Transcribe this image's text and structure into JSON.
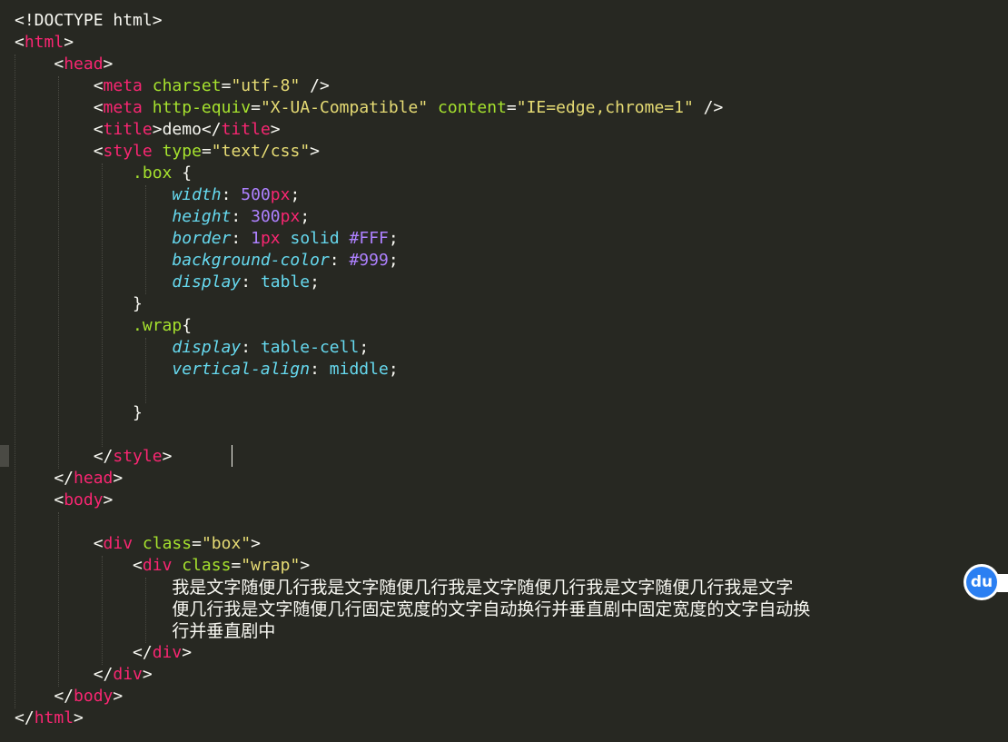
{
  "editor": {
    "lines": [
      [
        {
          "t": "<!DOCTYPE html>",
          "c": "fg"
        }
      ],
      [
        {
          "t": "<",
          "c": "fg"
        },
        {
          "t": "html",
          "c": "tg"
        },
        {
          "t": ">",
          "c": "fg"
        }
      ],
      [
        {
          "t": "    <",
          "c": "fg"
        },
        {
          "t": "head",
          "c": "tg"
        },
        {
          "t": ">",
          "c": "fg"
        }
      ],
      [
        {
          "t": "        <",
          "c": "fg"
        },
        {
          "t": "meta",
          "c": "tg"
        },
        {
          "t": " ",
          "c": "fg"
        },
        {
          "t": "charset",
          "c": "at"
        },
        {
          "t": "=",
          "c": "fg"
        },
        {
          "t": "\"utf-8\"",
          "c": "st"
        },
        {
          "t": " />",
          "c": "fg"
        }
      ],
      [
        {
          "t": "        <",
          "c": "fg"
        },
        {
          "t": "meta",
          "c": "tg"
        },
        {
          "t": " ",
          "c": "fg"
        },
        {
          "t": "http-equiv",
          "c": "at"
        },
        {
          "t": "=",
          "c": "fg"
        },
        {
          "t": "\"X-UA-Compatible\"",
          "c": "st"
        },
        {
          "t": " ",
          "c": "fg"
        },
        {
          "t": "content",
          "c": "at"
        },
        {
          "t": "=",
          "c": "fg"
        },
        {
          "t": "\"IE=edge,chrome=1\"",
          "c": "st"
        },
        {
          "t": " />",
          "c": "fg"
        }
      ],
      [
        {
          "t": "        <",
          "c": "fg"
        },
        {
          "t": "title",
          "c": "tg"
        },
        {
          "t": ">demo</",
          "c": "fg"
        },
        {
          "t": "title",
          "c": "tg"
        },
        {
          "t": ">",
          "c": "fg"
        }
      ],
      [
        {
          "t": "        <",
          "c": "fg"
        },
        {
          "t": "style",
          "c": "tg"
        },
        {
          "t": " ",
          "c": "fg"
        },
        {
          "t": "type",
          "c": "at"
        },
        {
          "t": "=",
          "c": "fg"
        },
        {
          "t": "\"text/css\"",
          "c": "st"
        },
        {
          "t": ">",
          "c": "fg"
        }
      ],
      [
        {
          "t": "            ",
          "c": "fg"
        },
        {
          "t": ".box",
          "c": "sel"
        },
        {
          "t": " {",
          "c": "fg"
        }
      ],
      [
        {
          "t": "                ",
          "c": "fg"
        },
        {
          "t": "width",
          "c": "pr"
        },
        {
          "t": ": ",
          "c": "fg"
        },
        {
          "t": "500",
          "c": "nu"
        },
        {
          "t": "px",
          "c": "un"
        },
        {
          "t": ";",
          "c": "fg"
        }
      ],
      [
        {
          "t": "                ",
          "c": "fg"
        },
        {
          "t": "height",
          "c": "pr"
        },
        {
          "t": ": ",
          "c": "fg"
        },
        {
          "t": "300",
          "c": "nu"
        },
        {
          "t": "px",
          "c": "un"
        },
        {
          "t": ";",
          "c": "fg"
        }
      ],
      [
        {
          "t": "                ",
          "c": "fg"
        },
        {
          "t": "border",
          "c": "pr"
        },
        {
          "t": ": ",
          "c": "fg"
        },
        {
          "t": "1",
          "c": "nu"
        },
        {
          "t": "px",
          "c": "un"
        },
        {
          "t": " ",
          "c": "fg"
        },
        {
          "t": "solid",
          "c": "kw"
        },
        {
          "t": " ",
          "c": "fg"
        },
        {
          "t": "#FFF",
          "c": "nu"
        },
        {
          "t": ";",
          "c": "fg"
        }
      ],
      [
        {
          "t": "                ",
          "c": "fg"
        },
        {
          "t": "background-color",
          "c": "pr"
        },
        {
          "t": ": ",
          "c": "fg"
        },
        {
          "t": "#999",
          "c": "nu"
        },
        {
          "t": ";",
          "c": "fg"
        }
      ],
      [
        {
          "t": "                ",
          "c": "fg"
        },
        {
          "t": "display",
          "c": "pr"
        },
        {
          "t": ": ",
          "c": "fg"
        },
        {
          "t": "table",
          "c": "kw"
        },
        {
          "t": ";",
          "c": "fg"
        }
      ],
      [
        {
          "t": "            }",
          "c": "fg"
        }
      ],
      [
        {
          "t": "            ",
          "c": "fg"
        },
        {
          "t": ".wrap",
          "c": "sel"
        },
        {
          "t": "{",
          "c": "fg"
        }
      ],
      [
        {
          "t": "                ",
          "c": "fg"
        },
        {
          "t": "display",
          "c": "pr"
        },
        {
          "t": ": ",
          "c": "fg"
        },
        {
          "t": "table-cell",
          "c": "kw"
        },
        {
          "t": ";",
          "c": "fg"
        }
      ],
      [
        {
          "t": "                ",
          "c": "fg"
        },
        {
          "t": "vertical-align",
          "c": "pr"
        },
        {
          "t": ": ",
          "c": "fg"
        },
        {
          "t": "middle",
          "c": "kw"
        },
        {
          "t": ";",
          "c": "fg"
        }
      ],
      [],
      [
        {
          "t": "            }",
          "c": "fg"
        }
      ],
      [],
      [
        {
          "t": "        </",
          "c": "fg"
        },
        {
          "t": "style",
          "c": "tg"
        },
        {
          "t": ">",
          "c": "fg"
        }
      ],
      [
        {
          "t": "    </",
          "c": "fg"
        },
        {
          "t": "head",
          "c": "tg"
        },
        {
          "t": ">",
          "c": "fg"
        }
      ],
      [
        {
          "t": "    <",
          "c": "fg"
        },
        {
          "t": "body",
          "c": "tg"
        },
        {
          "t": ">",
          "c": "fg"
        }
      ],
      [],
      [
        {
          "t": "        <",
          "c": "fg"
        },
        {
          "t": "div",
          "c": "tg"
        },
        {
          "t": " ",
          "c": "fg"
        },
        {
          "t": "class",
          "c": "at"
        },
        {
          "t": "=",
          "c": "fg"
        },
        {
          "t": "\"box\"",
          "c": "st"
        },
        {
          "t": ">",
          "c": "fg"
        }
      ],
      [
        {
          "t": "            <",
          "c": "fg"
        },
        {
          "t": "div",
          "c": "tg"
        },
        {
          "t": " ",
          "c": "fg"
        },
        {
          "t": "class",
          "c": "at"
        },
        {
          "t": "=",
          "c": "fg"
        },
        {
          "t": "\"wrap\"",
          "c": "st"
        },
        {
          "t": ">",
          "c": "fg"
        }
      ],
      [
        {
          "t": "                ",
          "c": "fg"
        },
        {
          "t": "我是文字随便几行我是文字随便几行我是文字随便几行我是文字随便几行我是文字",
          "c": "cjk"
        }
      ],
      [
        {
          "t": "                ",
          "c": "fg"
        },
        {
          "t": "便几行我是文字随便几行固定宽度的文字自动换行并垂直剧中固定宽度的文字自动换",
          "c": "cjk"
        }
      ],
      [
        {
          "t": "                ",
          "c": "fg"
        },
        {
          "t": "行并垂直剧中",
          "c": "cjk"
        }
      ],
      [
        {
          "t": "            </",
          "c": "fg"
        },
        {
          "t": "div",
          "c": "tg"
        },
        {
          "t": ">",
          "c": "fg"
        }
      ],
      [
        {
          "t": "        </",
          "c": "fg"
        },
        {
          "t": "div",
          "c": "tg"
        },
        {
          "t": ">",
          "c": "fg"
        }
      ],
      [
        {
          "t": "    </",
          "c": "fg"
        },
        {
          "t": "body",
          "c": "tg"
        },
        {
          "t": ">",
          "c": "fg"
        }
      ],
      [
        {
          "t": "</",
          "c": "fg"
        },
        {
          "t": "html",
          "c": "tg"
        },
        {
          "t": ">",
          "c": "fg"
        }
      ]
    ]
  },
  "overlay": {
    "badge_text": "du",
    "badge_icon": "baidu-du-icon"
  },
  "colors": {
    "background": "#272822",
    "foreground": "#F8F8F2",
    "tag": "#F92672",
    "attribute": "#A6E22E",
    "string": "#E6DB74",
    "property": "#66D9EF",
    "number": "#AE81FF",
    "badge": "#2b7ff2"
  }
}
